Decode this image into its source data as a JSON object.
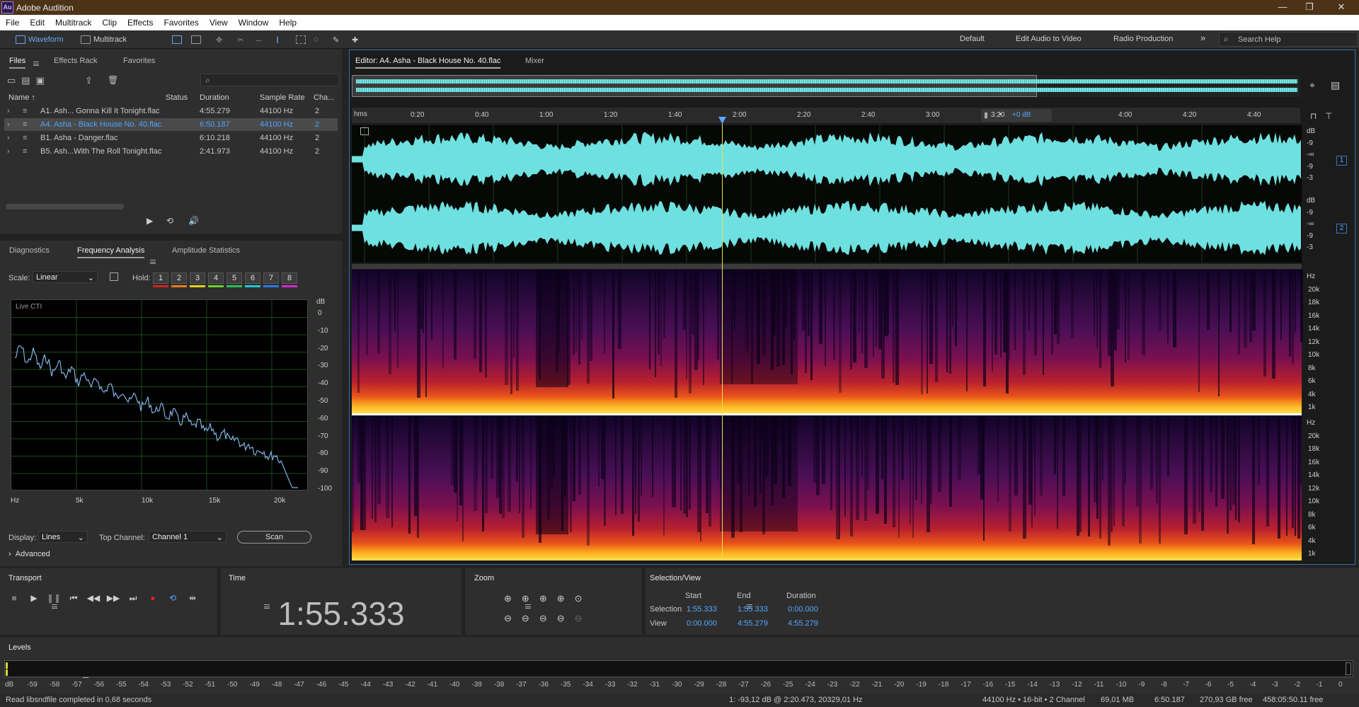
{
  "app": {
    "title": "Adobe Audition",
    "logo": "Au"
  },
  "window_controls": {
    "minimize": "—",
    "restore": "❐",
    "close": "✕"
  },
  "menu": [
    "File",
    "Edit",
    "Multitrack",
    "Clip",
    "Effects",
    "Favorites",
    "View",
    "Window",
    "Help"
  ],
  "toolbar": {
    "waveform_label": "Waveform",
    "multitrack_label": "Multitrack",
    "workspaces": [
      "Default",
      "Edit Audio to Video",
      "Radio Production"
    ],
    "more": "»",
    "search_placeholder": "Search Help"
  },
  "files_panel": {
    "tabs": [
      "Files",
      "Effects Rack",
      "Favorites"
    ],
    "columns": [
      "Name ↑",
      "Status",
      "Duration",
      "Sample Rate",
      "Cha..."
    ],
    "rows": [
      {
        "name": "A1. Ash... Gonna Kill It Tonight.flac",
        "duration": "4:55.279",
        "rate": "44100 Hz",
        "ch": "2"
      },
      {
        "name": "A4. Asha - Black House No. 40.flac",
        "duration": "6:50.187",
        "rate": "44100 Hz",
        "ch": "2"
      },
      {
        "name": "B1. Asha - Danger.flac",
        "duration": "6:10.218",
        "rate": "44100 Hz",
        "ch": "2"
      },
      {
        "name": "B5. Ash...With The Roll Tonight.flac",
        "duration": "2:41.973",
        "rate": "44100 Hz",
        "ch": "2"
      }
    ]
  },
  "analysis_panel": {
    "tabs": [
      "Diagnostics",
      "Frequency Analysis",
      "Amplitude Statistics"
    ],
    "scale_label": "Scale:",
    "scale_value": "Linear",
    "hold_label": "Hold:",
    "hold": [
      "1",
      "2",
      "3",
      "4",
      "5",
      "6",
      "7",
      "8"
    ],
    "hold_colors": [
      "#d42020",
      "#e67c1a",
      "#e3d21c",
      "#6ccf2b",
      "#2bbd5a",
      "#22c4d8",
      "#2b7be0",
      "#d22bd2"
    ],
    "graph_label": "Live CTI",
    "db_unit": "dB",
    "db_ticks": [
      "0",
      "-10",
      "-20",
      "-30",
      "-40",
      "-50",
      "-60",
      "-70",
      "-80",
      "-90",
      "-100"
    ],
    "hz_ticks": [
      "Hz",
      "5k",
      "10k",
      "15k",
      "20k"
    ],
    "display_label": "Display:",
    "display_value": "Lines",
    "top_channel_label": "Top Channel:",
    "top_channel_value": "Channel 1",
    "scan_button": "Scan",
    "advanced_label": "Advanced"
  },
  "editor": {
    "tab_label": "Editor: A4. Asha - Black House No. 40.flac",
    "mixer_label": "Mixer",
    "ruler_unit": "hms",
    "ruler_ticks": [
      "0:20",
      "0:40",
      "1:00",
      "1:20",
      "1:40",
      "2:00",
      "2:20",
      "2:40",
      "3:00",
      "3:20",
      "4:00",
      "4:20",
      "4:40"
    ],
    "gain_label": "+0 dB",
    "channel_badges": [
      "1",
      "2"
    ],
    "wave_scale": [
      "dB",
      "-9",
      "-∞",
      "-9",
      "-3"
    ],
    "spec_scale": [
      "Hz",
      "20k",
      "18k",
      "16k",
      "14k",
      "12k",
      "10k",
      "8k",
      "6k",
      "4k",
      "1k"
    ],
    "playhead_time_s": 115.333
  },
  "transport": {
    "title": "Transport"
  },
  "time": {
    "title": "Time",
    "value": "1:55.333"
  },
  "zoom": {
    "title": "Zoom"
  },
  "selection": {
    "title": "Selection/View",
    "headers": [
      "Start",
      "End",
      "Duration"
    ],
    "selection_label": "Selection",
    "view_label": "View",
    "selection": [
      "1:55.333",
      "1:55.333",
      "0:00.000"
    ],
    "view": [
      "0:00.000",
      "4:55.279",
      "4:55.279"
    ]
  },
  "levels": {
    "title": "Levels",
    "ticks": [
      "dB",
      "-59",
      "-58",
      "-57",
      "-56",
      "-55",
      "-54",
      "-53",
      "-52",
      "-51",
      "-50",
      "-49",
      "-48",
      "-47",
      "-46",
      "-45",
      "-44",
      "-43",
      "-42",
      "-41",
      "-40",
      "-39",
      "-38",
      "-37",
      "-36",
      "-35",
      "-34",
      "-33",
      "-32",
      "-31",
      "-30",
      "-29",
      "-28",
      "-27",
      "-26",
      "-25",
      "-24",
      "-23",
      "-22",
      "-21",
      "-20",
      "-19",
      "-18",
      "-17",
      "-16",
      "-15",
      "-14",
      "-13",
      "-12",
      "-11",
      "-10",
      "-9",
      "-8",
      "-7",
      "-6",
      "-5",
      "-4",
      "-3",
      "-2",
      "-1",
      "0"
    ]
  },
  "status": {
    "message": "Read libsndfile completed in 0,68 seconds",
    "cursor": "1: -93,12 dB @ 2:20.473, 20329,01 Hz",
    "format": "44100 Hz • 16-bit • 2 Channel",
    "size": "69,01 MB",
    "duration": "6:50.187",
    "free": "270,93 GB free",
    "free_time": "458:05:50.11 free"
  }
}
